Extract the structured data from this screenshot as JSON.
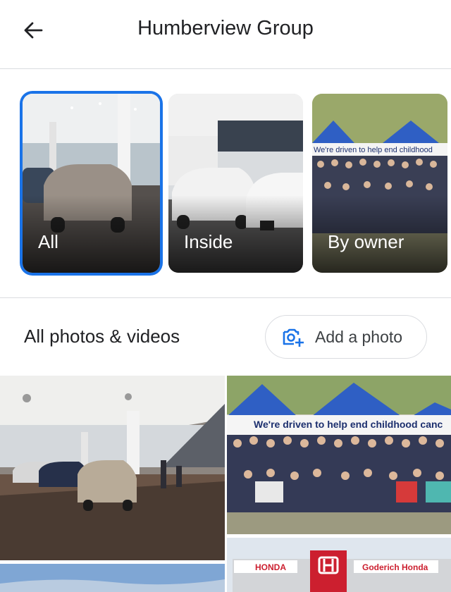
{
  "header": {
    "title": "Humberview Group",
    "back_icon": "arrow-left-icon"
  },
  "categories": [
    {
      "label": "All",
      "selected": true
    },
    {
      "label": "Inside",
      "selected": false
    },
    {
      "label": "By owner",
      "selected": false
    }
  ],
  "photos": {
    "section_title": "All photos & videos",
    "add_photo_label": "Add a photo",
    "add_photo_icon": "add-photo-camera-icon",
    "banner_text": "We're driven to help end childhood canc",
    "small_banner_text": "We're driven to help end childhood",
    "dealer_sign_brand": "HONDA",
    "dealer_sign_name": "Goderich Honda"
  },
  "colors": {
    "accent": "#1a73e8",
    "divider": "#dadce0",
    "honda_red": "#cc1f2f",
    "tent_blue": "#2f5fc4"
  }
}
